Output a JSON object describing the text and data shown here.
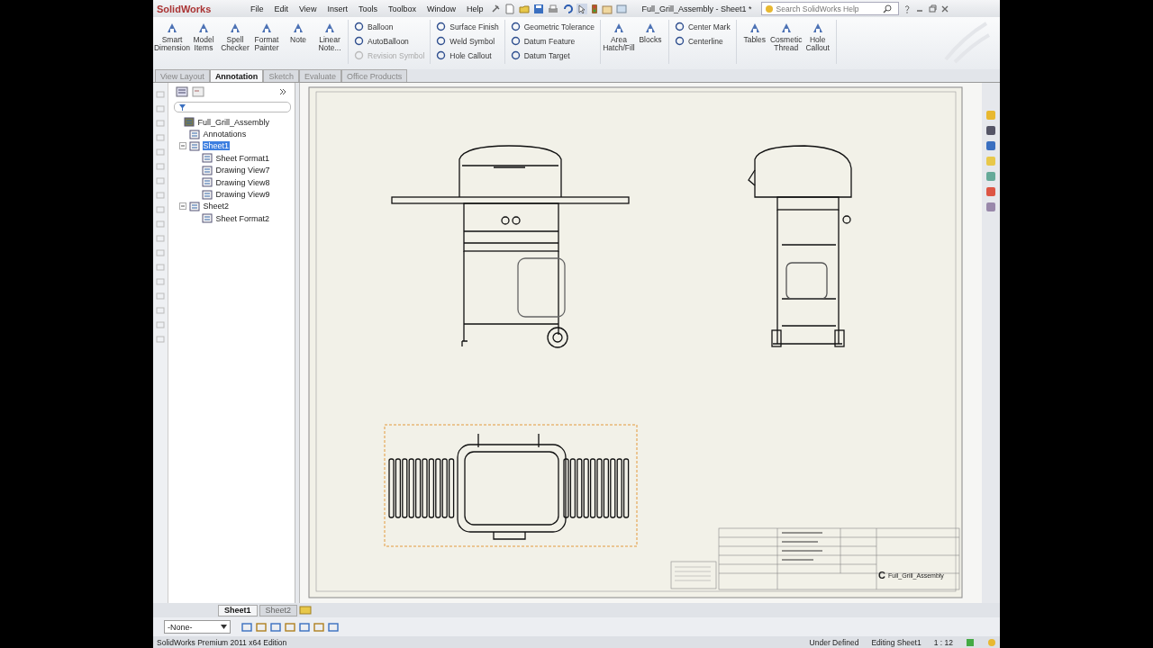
{
  "app": {
    "logo": "SolidWorks",
    "menus": [
      "File",
      "Edit",
      "View",
      "Insert",
      "Tools",
      "Toolbox",
      "Window",
      "Help"
    ],
    "document_title": "Full_Grill_Assembly - Sheet1 *",
    "search": {
      "placeholder": "Search SolidWorks Help"
    }
  },
  "ribbon": {
    "groups": [
      {
        "kind": "large",
        "items": [
          {
            "label": "Smart Dimension"
          },
          {
            "label": "Model Items"
          },
          {
            "label": "Spell Checker"
          },
          {
            "label": "Format Painter"
          },
          {
            "label": "Note"
          },
          {
            "label": "Linear Note..."
          }
        ]
      },
      {
        "kind": "stack",
        "items": [
          {
            "label": "Balloon",
            "disabled": false
          },
          {
            "label": "AutoBalloon",
            "disabled": false
          },
          {
            "label": "Revision Symbol",
            "disabled": true
          }
        ]
      },
      {
        "kind": "stack",
        "items": [
          {
            "label": "Surface Finish",
            "disabled": false
          },
          {
            "label": "Weld Symbol",
            "disabled": false
          },
          {
            "label": "Hole Callout",
            "disabled": false
          }
        ]
      },
      {
        "kind": "stack",
        "items": [
          {
            "label": "Geometric Tolerance",
            "disabled": false
          },
          {
            "label": "Datum Feature",
            "disabled": false
          },
          {
            "label": "Datum Target",
            "disabled": false
          }
        ]
      },
      {
        "kind": "large",
        "items": [
          {
            "label": "Area Hatch/Fill"
          },
          {
            "label": "Blocks"
          }
        ]
      },
      {
        "kind": "stack",
        "items": [
          {
            "label": "Center Mark",
            "disabled": false
          },
          {
            "label": "Centerline",
            "disabled": false
          }
        ]
      },
      {
        "kind": "large",
        "items": [
          {
            "label": "Tables"
          },
          {
            "label": "Cosmetic Thread"
          },
          {
            "label": "Hole Callout"
          }
        ]
      }
    ]
  },
  "tabs": [
    {
      "label": "View Layout",
      "selected": false
    },
    {
      "label": "Annotation",
      "selected": true
    },
    {
      "label": "Sketch",
      "selected": false
    },
    {
      "label": "Evaluate",
      "selected": false
    },
    {
      "label": "Office Products",
      "selected": false
    }
  ],
  "tree": [
    {
      "label": "Full_Grill_Assembly",
      "selected": false,
      "children": [
        {
          "label": "Annotations",
          "selected": false
        },
        {
          "label": "Sheet1",
          "selected": true,
          "children": [
            {
              "label": "Sheet Format1",
              "selected": false
            },
            {
              "label": "Drawing View7",
              "selected": false
            },
            {
              "label": "Drawing View8",
              "selected": false
            },
            {
              "label": "Drawing View9",
              "selected": false
            }
          ]
        },
        {
          "label": "Sheet2",
          "selected": false,
          "children": [
            {
              "label": "Sheet Format2",
              "selected": false
            }
          ]
        }
      ]
    }
  ],
  "title_block": {
    "size": "C",
    "name": "Full_Grill_Assembly"
  },
  "sheet_tabs": [
    {
      "label": "Sheet1",
      "selected": true
    },
    {
      "label": "Sheet2",
      "selected": false
    }
  ],
  "layer_select": {
    "value": "-None-"
  },
  "status_bar": {
    "edition": "SolidWorks Premium 2011 x64 Edition",
    "state": "Under Defined",
    "editing": "Editing Sheet1",
    "scale": "1 : 12"
  }
}
